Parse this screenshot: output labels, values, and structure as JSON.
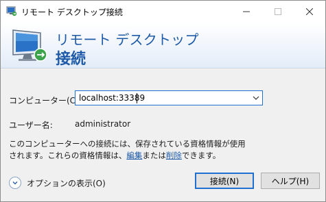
{
  "window": {
    "title": "リモート デスクトップ接続"
  },
  "banner": {
    "title": "リモート デスクトップ",
    "subtitle": "接続"
  },
  "form": {
    "computer_label": "コンピューター(C):",
    "computer_value": "localhost:33389",
    "user_label": "ユーザー名:",
    "user_value": "administrator"
  },
  "info": {
    "prefix": "このコンピューターへの接続には、保存されている資格情報が使用されます。これらの資格情報は、",
    "edit_link": "編集",
    "middle": "または",
    "delete_link": "削除",
    "suffix": "できます。"
  },
  "options": {
    "label": "オプションの表示(O)"
  },
  "buttons": {
    "connect": "接続(N)",
    "help": "ヘルプ(H)"
  },
  "colors": {
    "accent": "#1e5aa8",
    "focus_border": "#1f6fd0"
  }
}
